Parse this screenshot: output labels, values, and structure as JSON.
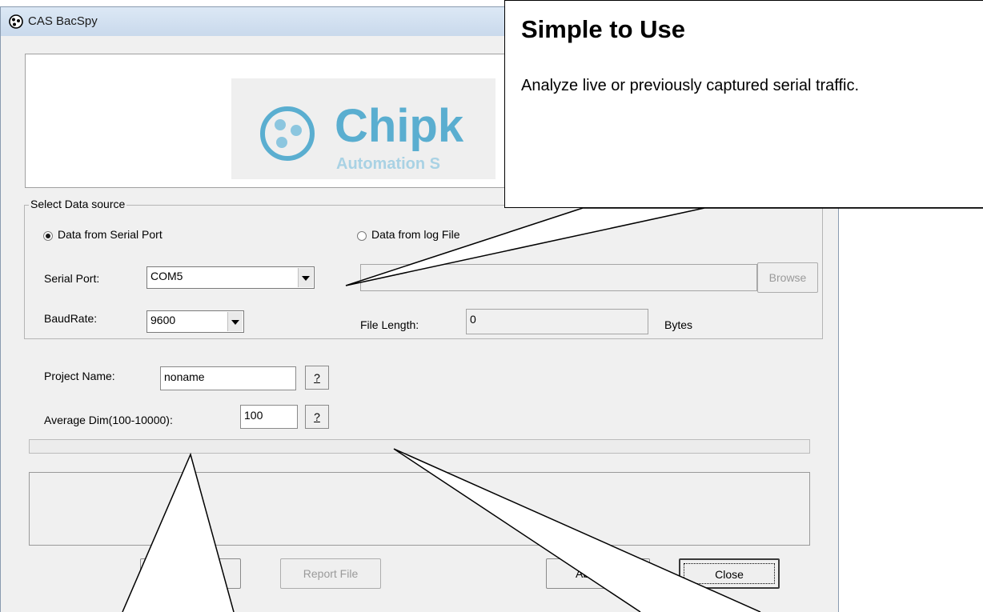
{
  "window": {
    "title": "CAS BacSpy"
  },
  "banner": {
    "logo_text": "Chipk",
    "logo_sub": "Automation S"
  },
  "datasource": {
    "legend": "Select Data source",
    "serial_radio_label": "Data from Serial Port",
    "log_radio_label": "Data from log File",
    "selected": "serial",
    "serial_port_label": "Serial Port:",
    "serial_port_value": "COM5",
    "baudrate_label": "BaudRate:",
    "baudrate_value": "9600",
    "log_path_value": "",
    "browse_label": "Browse",
    "file_length_label": "File Length:",
    "file_length_value": "0",
    "bytes_label": "Bytes"
  },
  "project": {
    "name_label": "Project Name:",
    "name_value": "noname",
    "avg_label": "Average Dim(100-10000):",
    "avg_value": "100",
    "help_label": "?"
  },
  "progress": {
    "value_percent": 0
  },
  "buttons": {
    "report_file": "Report File",
    "about_partial": "Ab",
    "close": "Close"
  },
  "callout": {
    "heading": "Simple to Use",
    "body": "Analyze live or previously captured serial traffic."
  }
}
